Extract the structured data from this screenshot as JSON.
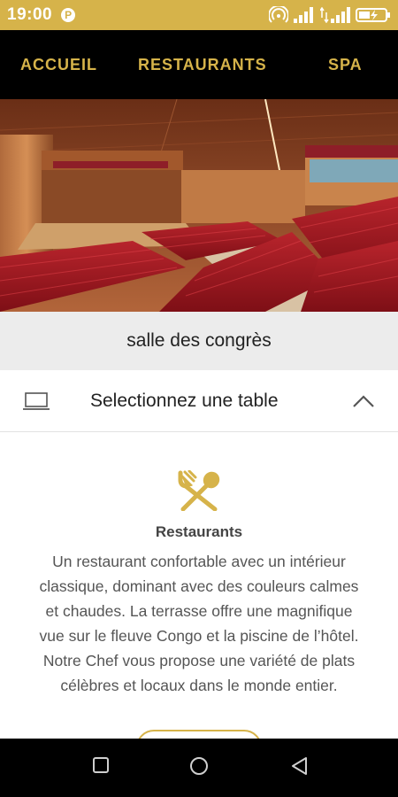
{
  "status_bar": {
    "time": "19:00",
    "app_icon": "P",
    "icons": [
      "hotspot-icon",
      "signal-icon",
      "signal-2-icon",
      "battery-charging-icon"
    ],
    "color": "#d6b34a"
  },
  "nav": {
    "items": [
      {
        "label": "ACCUEIL"
      },
      {
        "label": "RESTAURANTS"
      },
      {
        "label": "SPA"
      }
    ],
    "accent_color": "#d6b34a",
    "background": "#000000"
  },
  "hero": {
    "alt": "conference hall photo with red seats"
  },
  "caption": {
    "text": "salle des congrès"
  },
  "table_selector": {
    "label": "Selectionnez une table",
    "icon": "laptop-icon",
    "chevron": "chevron-up-icon"
  },
  "restaurant": {
    "icon": "fork-spoon-icon",
    "title": "Restaurants",
    "description": "Un restaurant confortable avec un intérieur classique, dominant avec des couleurs calmes et chaudes. La terrasse offre une magnifique vue sur le fleuve Congo et la piscine de l’hôtel. Notre Chef vous propose une variété de plats célèbres et locaux dans le monde entier."
  },
  "system_nav": {
    "icons": [
      "recents-square-icon",
      "home-circle-icon",
      "back-triangle-icon"
    ]
  }
}
